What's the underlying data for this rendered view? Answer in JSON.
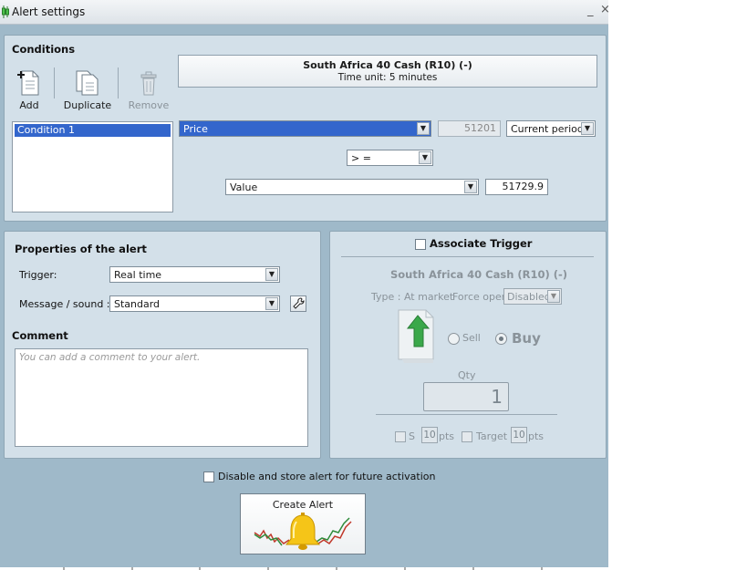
{
  "window": {
    "title": "Alert settings",
    "minimize": "_",
    "close": "×"
  },
  "conditions": {
    "header": "Conditions",
    "toolbar": {
      "add": "Add",
      "duplicate": "Duplicate",
      "remove": "Remove"
    },
    "instrument": {
      "name": "South Africa 40 Cash (R10) (-)",
      "time_unit": "Time unit: 5 minutes"
    },
    "list": [
      "Condition 1"
    ],
    "indicator": "Price",
    "current_value": "51201",
    "period": "Current period",
    "operator": "> =",
    "compare_to": "Value",
    "threshold": "51729.9"
  },
  "properties": {
    "header": "Properties of the alert",
    "trigger_label": "Trigger:",
    "trigger_value": "Real time",
    "message_label": "Message / sound :",
    "message_value": "Standard",
    "comment_header": "Comment",
    "comment_placeholder": "You can add a comment to your alert."
  },
  "trigger": {
    "associate_label": "Associate Trigger",
    "associate_checked": false,
    "instrument": "South Africa 40 Cash (R10) (-)",
    "type_label": "Type : At market",
    "force_open_label": "Force open",
    "force_open_value": "Disabled",
    "sell_label": "Sell",
    "buy_label": "Buy",
    "selected_side": "Buy",
    "qty_label": "Qty",
    "qty_value": "1",
    "stop_label": "S",
    "stop_value": "10",
    "stop_unit": "pts",
    "target_label": "Target",
    "target_value": "10",
    "target_unit": "pts"
  },
  "footer": {
    "disable_label": "Disable and store alert for future activation",
    "create_button": "Create Alert"
  },
  "colors": {
    "window_bg": "#9fb9c9",
    "panel_bg": "#d3e0e9",
    "selection": "#3366cc",
    "arrow_green": "#3aa84a"
  }
}
